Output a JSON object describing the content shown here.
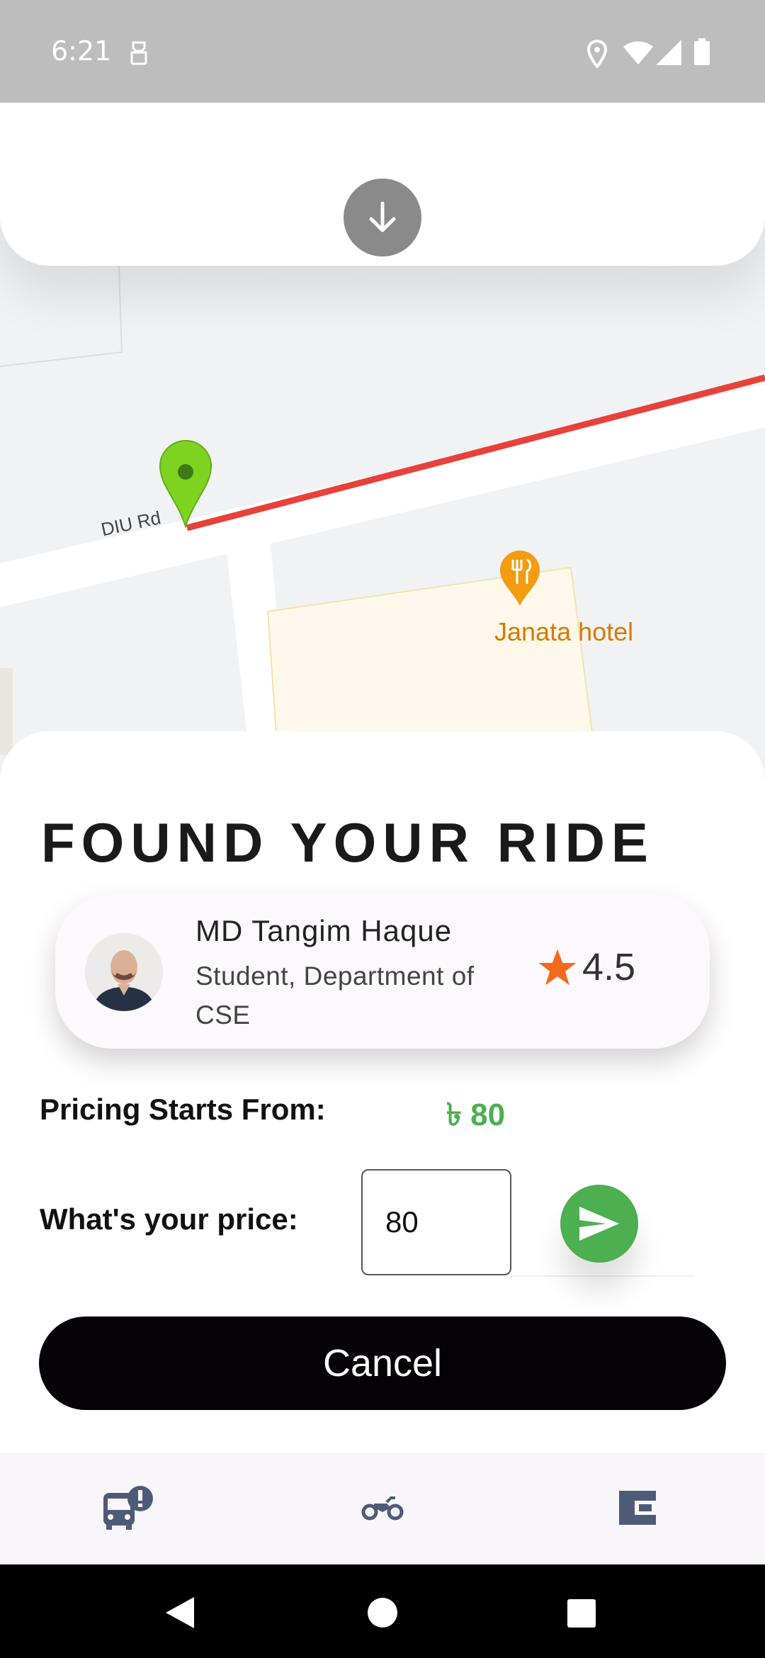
{
  "status_bar": {
    "time": "6:21"
  },
  "map": {
    "road_name": "DIU Rd",
    "poi_name": "Janata hotel",
    "route_color": "#e8413a",
    "pin_color": "#7ed321"
  },
  "sheet": {
    "title": "FOUND YOUR RIDE",
    "driver": {
      "name": "MD Tangim Haque",
      "subtitle": "Student, Department of CSE",
      "rating": "4.5"
    },
    "pricing_label": "Pricing Starts From:",
    "pricing_value": "৳ 80",
    "price_prompt": "What's your price:",
    "price_input_value": "80",
    "cancel_label": "Cancel"
  },
  "bottom_nav": [
    "bus-alert-icon",
    "motorcycle-icon",
    "wallet-icon"
  ],
  "colors": {
    "accent_green": "#4caf50",
    "rating_star": "#f26a1b",
    "nav_icon": "#4d5b78"
  }
}
